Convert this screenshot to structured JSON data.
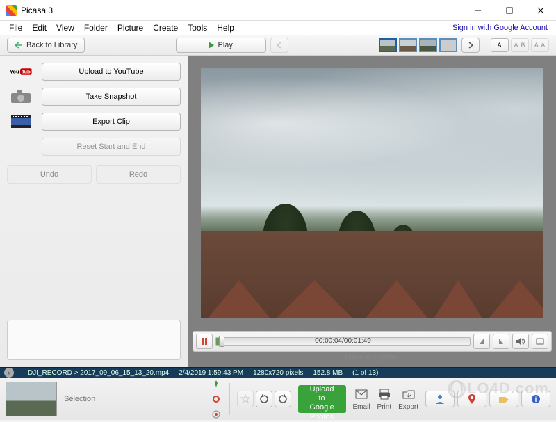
{
  "window": {
    "title": "Picasa 3"
  },
  "menu": {
    "items": [
      "File",
      "Edit",
      "View",
      "Folder",
      "Picture",
      "Create",
      "Tools",
      "Help"
    ],
    "signin": "Sign in with Google Account"
  },
  "toolbar": {
    "back": "Back to Library",
    "play": "Play",
    "textsize": [
      "A",
      "A B",
      "A A"
    ]
  },
  "sidebar": {
    "youtube": "Upload to YouTube",
    "snapshot": "Take Snapshot",
    "export": "Export Clip",
    "reset": "Reset Start and End",
    "undo": "Undo",
    "redo": "Redo"
  },
  "player": {
    "time_current": "00:00:04",
    "time_total": "00:01:49"
  },
  "caption": {
    "placeholder": "Make a caption!"
  },
  "info": {
    "path": "DJI_RECORD > 2017_09_06_15_13_20.mp4",
    "date": "2/4/2019 1:59:43 PM",
    "dimensions": "1280x720 pixels",
    "size": "152.8 MB",
    "index": "(1 of 13)"
  },
  "tray": {
    "selection": "Selection",
    "upload": "Upload to Google Photos",
    "actions": {
      "email": "Email",
      "print": "Print",
      "export": "Export"
    }
  },
  "watermark": "LO4D.com"
}
